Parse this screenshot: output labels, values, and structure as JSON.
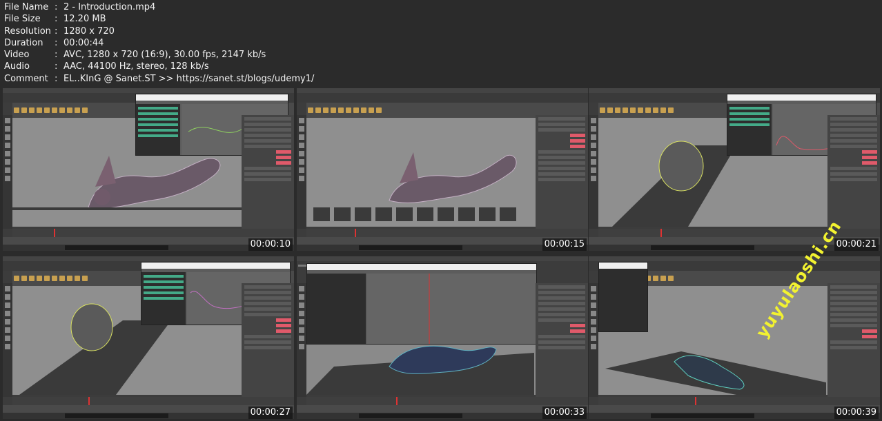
{
  "info": {
    "rows": [
      {
        "key": "File Name",
        "value": "2 - Introduction.mp4"
      },
      {
        "key": "File Size",
        "value": "12.20 MB"
      },
      {
        "key": "Resolution",
        "value": "1280 x 720"
      },
      {
        "key": "Duration",
        "value": "00:00:44"
      },
      {
        "key": "Video",
        "value": "AVC, 1280 x 720 (16:9), 30.00 fps, 2147 kb/s"
      },
      {
        "key": "Audio",
        "value": "AAC, 44100 Hz, stereo, 128 kb/s"
      },
      {
        "key": "Comment",
        "value": "EL..KInG @ Sanet.ST >> https://sanet.st/blogs/udemy1/"
      }
    ]
  },
  "thumbnails": [
    {
      "timestamp": "00:00:10"
    },
    {
      "timestamp": "00:00:15"
    },
    {
      "timestamp": "00:00:21"
    },
    {
      "timestamp": "00:00:27"
    },
    {
      "timestamp": "00:00:33"
    },
    {
      "timestamp": "00:00:39"
    }
  ],
  "watermark": "yuyulaoshi.cn",
  "colors": {
    "background": "#2b2b2b",
    "viewport": "#8f8f8f",
    "watermark": "#f2f230",
    "channel_highlight": "#e05a6a"
  }
}
